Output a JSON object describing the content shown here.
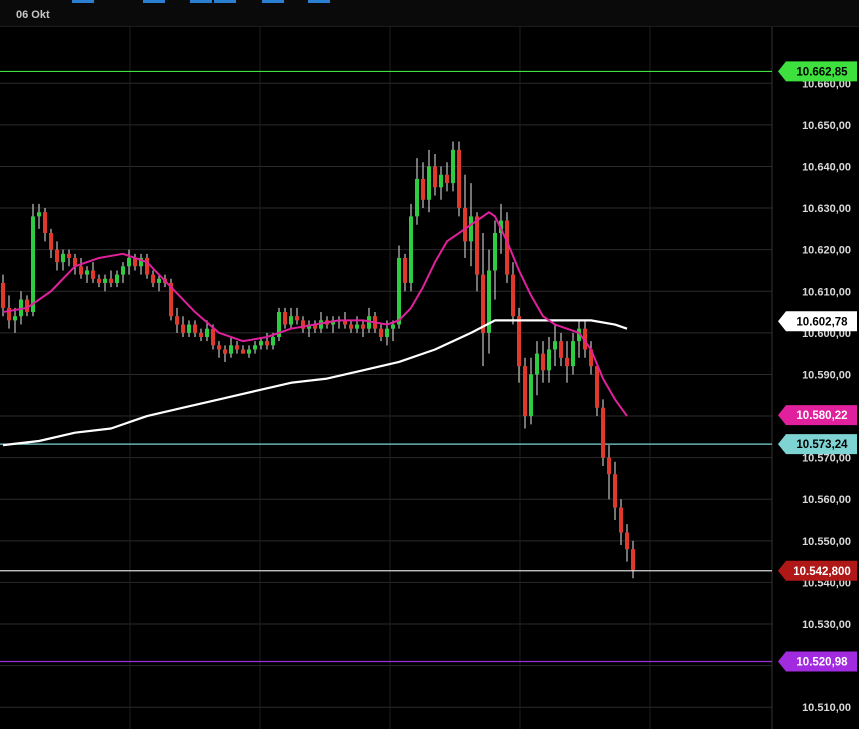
{
  "toolbar": {
    "date_label": "06 Okt"
  },
  "chart_data": {
    "type": "candlestick",
    "title": "",
    "xlabel": "",
    "ylabel": "",
    "ylim": [
      10505,
      10668
    ],
    "y_ticks": [
      10510,
      10520,
      10530,
      10540,
      10550,
      10560,
      10570,
      10580,
      10590,
      10600,
      10610,
      10620,
      10630,
      10640,
      10650,
      10660
    ],
    "y_tick_labels": [
      "10.510,00",
      "10.520,00",
      "10.530,00",
      "10.540,00",
      "10.550,00",
      "10.560,00",
      "10.570,00",
      "10.580,00",
      "10.590,00",
      "10.600,00",
      "10.610,00",
      "10.620,00",
      "10.630,00",
      "10.640,00",
      "10.650,00",
      "10.660,00"
    ],
    "grid": true,
    "horizontal_levels": [
      {
        "value": 10662.85,
        "label": "10.662,85",
        "color": "#3de03d",
        "text_color": "#000000"
      },
      {
        "value": 10573.24,
        "label": "10.573,24",
        "color": "#7ed3d3",
        "text_color": "#000000"
      },
      {
        "value": 10542.8,
        "label": "10.542,800",
        "color": "#d6d6d6",
        "tag_color": "#b01818",
        "text_color": "#ffffff"
      },
      {
        "value": 10520.98,
        "label": "10.520,98",
        "color": "#9b2fd6",
        "tag_color": "#a22be0",
        "text_color": "#ffffff"
      }
    ],
    "indicator_tags": [
      {
        "value": 10602.78,
        "label": "10.602,78",
        "color": "#ffffff",
        "text_color": "#000000"
      },
      {
        "value": 10580.22,
        "label": "10.580,22",
        "color": "#e0209c",
        "text_color": "#ffffff"
      }
    ],
    "candles": [
      [
        10612,
        10614,
        10604,
        10606
      ],
      [
        10606,
        10609,
        10601,
        10603
      ],
      [
        10603,
        10606,
        10600,
        10604
      ],
      [
        10604,
        10610,
        10602,
        10608
      ],
      [
        10608,
        10609,
        10604,
        10605
      ],
      [
        10605,
        10631,
        10604,
        10628
      ],
      [
        10628,
        10631,
        10625,
        10629
      ],
      [
        10629,
        10630,
        10622,
        10624
      ],
      [
        10624,
        10625,
        10618,
        10620
      ],
      [
        10620,
        10622,
        10615,
        10617
      ],
      [
        10617,
        10620,
        10615,
        10619
      ],
      [
        10619,
        10620,
        10616,
        10618
      ],
      [
        10618,
        10619,
        10614,
        10616
      ],
      [
        10616,
        10618,
        10613,
        10614
      ],
      [
        10614,
        10616,
        10612,
        10615
      ],
      [
        10615,
        10617,
        10612,
        10613
      ],
      [
        10613,
        10614,
        10611,
        10612
      ],
      [
        10612,
        10614,
        10610,
        10613
      ],
      [
        10613,
        10615,
        10611,
        10612
      ],
      [
        10612,
        10615,
        10611,
        10614
      ],
      [
        10614,
        10617,
        10612,
        10616
      ],
      [
        10616,
        10620,
        10614,
        10618
      ],
      [
        10618,
        10619,
        10615,
        10616
      ],
      [
        10616,
        10619,
        10614,
        10618
      ],
      [
        10618,
        10619,
        10613,
        10614
      ],
      [
        10614,
        10615,
        10611,
        10612
      ],
      [
        10612,
        10614,
        10610,
        10613
      ],
      [
        10613,
        10614,
        10611,
        10612
      ],
      [
        10612,
        10613,
        10603,
        10604
      ],
      [
        10604,
        10606,
        10600,
        10602
      ],
      [
        10602,
        10604,
        10599,
        10600
      ],
      [
        10600,
        10603,
        10599,
        10602
      ],
      [
        10602,
        10603,
        10599,
        10600
      ],
      [
        10600,
        10601,
        10598,
        10599
      ],
      [
        10599,
        10603,
        10598,
        10601
      ],
      [
        10601,
        10602,
        10596,
        10597
      ],
      [
        10597,
        10598,
        10594,
        10596
      ],
      [
        10596,
        10597,
        10593,
        10595
      ],
      [
        10595,
        10599,
        10594,
        10597
      ],
      [
        10597,
        10598,
        10595,
        10596
      ],
      [
        10596,
        10597,
        10595,
        10595
      ],
      [
        10595,
        10597,
        10594,
        10596
      ],
      [
        10596,
        10598,
        10595,
        10597
      ],
      [
        10597,
        10599,
        10596,
        10598
      ],
      [
        10598,
        10600,
        10596,
        10597
      ],
      [
        10597,
        10600,
        10596,
        10599
      ],
      [
        10599,
        10606,
        10598,
        10605
      ],
      [
        10605,
        10606,
        10601,
        10602
      ],
      [
        10602,
        10606,
        10601,
        10604
      ],
      [
        10604,
        10606,
        10602,
        10603
      ],
      [
        10603,
        10604,
        10600,
        10601
      ],
      [
        10601,
        10603,
        10599,
        10602
      ],
      [
        10602,
        10603,
        10600,
        10601
      ],
      [
        10601,
        10605,
        10600,
        10603
      ],
      [
        10603,
        10604,
        10601,
        10602
      ],
      [
        10602,
        10604,
        10600,
        10603
      ],
      [
        10603,
        10604,
        10601,
        10603
      ],
      [
        10603,
        10605,
        10601,
        10602
      ],
      [
        10602,
        10603,
        10600,
        10601
      ],
      [
        10601,
        10604,
        10600,
        10602
      ],
      [
        10602,
        10603,
        10599,
        10601
      ],
      [
        10601,
        10606,
        10600,
        10604
      ],
      [
        10604,
        10605,
        10600,
        10601
      ],
      [
        10601,
        10602,
        10598,
        10599
      ],
      [
        10599,
        10603,
        10597,
        10601
      ],
      [
        10601,
        10603,
        10598,
        10602
      ],
      [
        10602,
        10621,
        10601,
        10618
      ],
      [
        10618,
        10619,
        10610,
        10612
      ],
      [
        10612,
        10631,
        10610,
        10628
      ],
      [
        10628,
        10642,
        10626,
        10637
      ],
      [
        10637,
        10641,
        10630,
        10632
      ],
      [
        10632,
        10644,
        10629,
        10640
      ],
      [
        10640,
        10643,
        10633,
        10635
      ],
      [
        10635,
        10640,
        10632,
        10638
      ],
      [
        10638,
        10641,
        10634,
        10636
      ],
      [
        10636,
        10646,
        10634,
        10644
      ],
      [
        10644,
        10646,
        10628,
        10630
      ],
      [
        10630,
        10638,
        10618,
        10622
      ],
      [
        10622,
        10636,
        10616,
        10628
      ],
      [
        10628,
        10629,
        10610,
        10614
      ],
      [
        10614,
        10624,
        10592,
        10600
      ],
      [
        10600,
        10620,
        10595,
        10615
      ],
      [
        10615,
        10627,
        10608,
        10624
      ],
      [
        10624,
        10631,
        10619,
        10627
      ],
      [
        10627,
        10629,
        10612,
        10614
      ],
      [
        10614,
        10617,
        10602,
        10604
      ],
      [
        10604,
        10606,
        10588,
        10592
      ],
      [
        10592,
        10594,
        10577,
        10580
      ],
      [
        10580,
        10594,
        10578,
        10590
      ],
      [
        10590,
        10598,
        10585,
        10595
      ],
      [
        10595,
        10598,
        10588,
        10591
      ],
      [
        10591,
        10599,
        10588,
        10596
      ],
      [
        10596,
        10602,
        10592,
        10598
      ],
      [
        10598,
        10600,
        10592,
        10594
      ],
      [
        10594,
        10598,
        10588,
        10592
      ],
      [
        10592,
        10600,
        10590,
        10598
      ],
      [
        10598,
        10603,
        10594,
        10601
      ],
      [
        10601,
        10603,
        10594,
        10596
      ],
      [
        10596,
        10598,
        10590,
        10592
      ],
      [
        10592,
        10593,
        10580,
        10582
      ],
      [
        10582,
        10584,
        10568,
        10570
      ],
      [
        10570,
        10573,
        10560,
        10566
      ],
      [
        10566,
        10569,
        10555,
        10558
      ],
      [
        10558,
        10560,
        10549,
        10552
      ],
      [
        10552,
        10554,
        10545,
        10548
      ],
      [
        10548,
        10550,
        10541,
        10543
      ]
    ],
    "sma_short_color": "#e0209c",
    "sma_long_color": "#ffffff",
    "sma_short": [
      [
        0,
        10605
      ],
      [
        4,
        10606
      ],
      [
        8,
        10610
      ],
      [
        12,
        10616
      ],
      [
        16,
        10618
      ],
      [
        20,
        10619
      ],
      [
        24,
        10617
      ],
      [
        28,
        10611
      ],
      [
        32,
        10605
      ],
      [
        36,
        10600
      ],
      [
        40,
        10598
      ],
      [
        44,
        10599
      ],
      [
        48,
        10601
      ],
      [
        52,
        10602
      ],
      [
        56,
        10603
      ],
      [
        60,
        10603
      ],
      [
        64,
        10602
      ],
      [
        66,
        10603
      ],
      [
        68,
        10606
      ],
      [
        70,
        10611
      ],
      [
        72,
        10617
      ],
      [
        74,
        10622
      ],
      [
        76,
        10624
      ],
      [
        78,
        10626
      ],
      [
        80,
        10628
      ],
      [
        81,
        10629
      ],
      [
        82,
        10628
      ],
      [
        84,
        10622
      ],
      [
        86,
        10615
      ],
      [
        88,
        10609
      ],
      [
        90,
        10604
      ],
      [
        92,
        10602
      ],
      [
        94,
        10601
      ],
      [
        96,
        10600
      ],
      [
        98,
        10596
      ],
      [
        100,
        10589
      ],
      [
        102,
        10584
      ],
      [
        104,
        10580
      ]
    ],
    "sma_long": [
      [
        0,
        10573
      ],
      [
        6,
        10574
      ],
      [
        12,
        10576
      ],
      [
        18,
        10577
      ],
      [
        24,
        10580
      ],
      [
        30,
        10582
      ],
      [
        36,
        10584
      ],
      [
        42,
        10586
      ],
      [
        48,
        10588
      ],
      [
        54,
        10589
      ],
      [
        60,
        10591
      ],
      [
        66,
        10593
      ],
      [
        72,
        10596
      ],
      [
        78,
        10600
      ],
      [
        82,
        10603
      ],
      [
        86,
        10603
      ],
      [
        90,
        10603
      ],
      [
        94,
        10603
      ],
      [
        98,
        10603
      ],
      [
        102,
        10602
      ],
      [
        104,
        10601
      ]
    ],
    "colors": {
      "up": "#2ecc40",
      "down": "#e0392b",
      "wick": "#e8e8e8",
      "grid": "#2a2a2a",
      "axis_bg": "#000000"
    }
  }
}
